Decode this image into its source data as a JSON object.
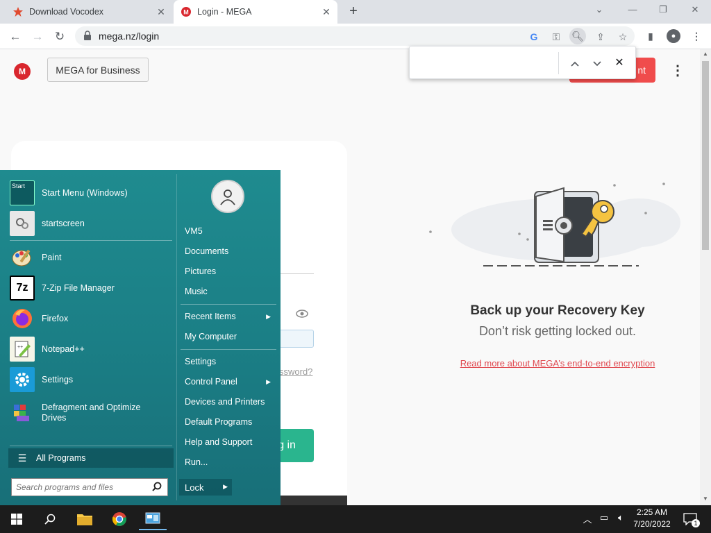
{
  "browser": {
    "tabs": [
      {
        "title": "Download Vocodex",
        "icon": "star-icon",
        "close": "✕"
      },
      {
        "title": "Login - MEGA",
        "icon": "mega-icon",
        "close": "✕"
      }
    ],
    "new_tab": "+",
    "url": "mega.nz/login",
    "find_bar": {
      "value": "",
      "up": "⌃",
      "down": "⌄",
      "close": "✕"
    }
  },
  "page": {
    "logo_letter": "M",
    "business_button": "MEGA for Business",
    "create_account_partial": "nt",
    "forgot_partial": "ssword?",
    "login_partial": "g in",
    "recovery": {
      "title": "Back up your Recovery Key",
      "subtitle": "Don’t risk getting locked out.",
      "link": "Read more about MEGA’s end-to-end encryption"
    }
  },
  "start_menu": {
    "programs": [
      {
        "label": "Start Menu (Windows)",
        "icon": "start-menu-icon"
      },
      {
        "label": "startscreen",
        "icon": "startscreen-icon"
      },
      {
        "label": "Paint",
        "icon": "paint-icon"
      },
      {
        "label": "7-Zip File Manager",
        "icon": "7zip-icon"
      },
      {
        "label": "Firefox",
        "icon": "firefox-icon"
      },
      {
        "label": "Notepad++",
        "icon": "notepadpp-icon"
      },
      {
        "label": "Settings",
        "icon": "settings-icon"
      },
      {
        "label": "Defragment and Optimize Drives",
        "icon": "defrag-icon"
      }
    ],
    "start_icon_text": "Start",
    "zip_icon_text": "7z",
    "all_programs": "All Programs",
    "search_placeholder": "Search programs and files",
    "right": {
      "user": "VM5",
      "items1": [
        "Documents",
        "Pictures",
        "Music"
      ],
      "items2": [
        "Recent Items",
        "My Computer"
      ],
      "items3": [
        "Settings",
        "Control Panel",
        "Devices and Printers",
        "Default Programs",
        "Help and Support",
        "Run..."
      ],
      "lock": "Lock"
    }
  },
  "taskbar": {
    "time": "2:25 AM",
    "date": "7/20/2022",
    "notification_count": "1"
  }
}
